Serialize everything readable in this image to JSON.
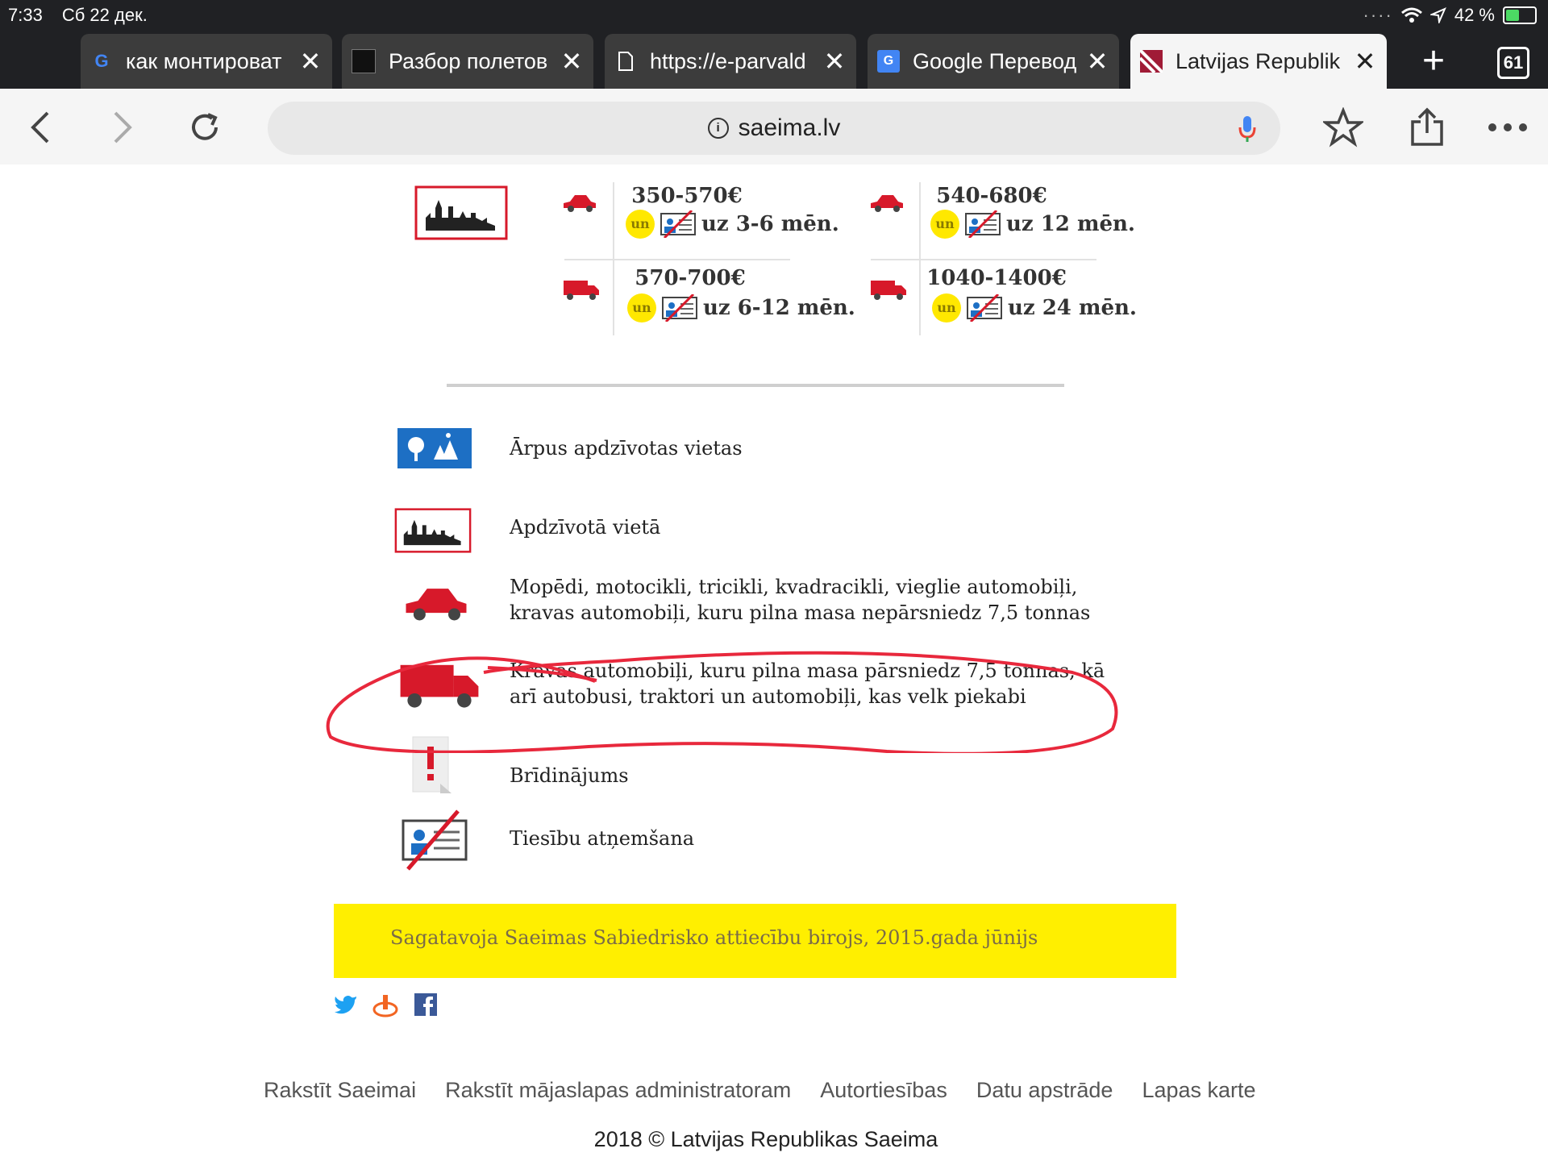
{
  "status": {
    "time": "7:33",
    "date": "Сб 22 дек.",
    "battery": "42 %",
    "battery_level": 0.42
  },
  "tabs": [
    {
      "title": "как монтироват",
      "favicon": "google-icon"
    },
    {
      "title": "Разбор полетов",
      "favicon": "site-icon"
    },
    {
      "title": "https://e-parvald",
      "favicon": "document-icon"
    },
    {
      "title": "Google Перевод",
      "favicon": "google-translate-icon"
    },
    {
      "title": "Latvijas Republik",
      "favicon": "saeima-icon",
      "active": true
    }
  ],
  "tab_count": "61",
  "url": "saeima.lv",
  "penalties": [
    {
      "price": "350-570€",
      "un": "un",
      "duration": "uz 3-6 mēn.",
      "vehicle": "car"
    },
    {
      "price": "540-680€",
      "un": "un",
      "duration": "uz 12 mēn.",
      "vehicle": "car"
    },
    {
      "price": "570-700€",
      "un": "un",
      "duration": "uz 6-12 mēn.",
      "vehicle": "truck"
    },
    {
      "price": "1040-1400€",
      "un": "un",
      "duration": "uz 24 mēn.",
      "vehicle": "truck"
    }
  ],
  "legend": {
    "outside": "Ārpus apdzīvotas vietas",
    "inside": "Apdzīvotā vietā",
    "car": "Mopēdi, motocikli, tricikli, kvadracikli, vieglie automobiļi, kravas automobiļi, kuru pilna masa nepārsniedz 7,5 tonnas",
    "truck": "Kravas automobiļi, kuru pilna masa pārsniedz 7,5 tonnas, kā arī autobusi, traktori un automobiļi, kas velk piekabi",
    "warning": "Brīdinājums",
    "license": "Tiesību atņemšana"
  },
  "banner": "Sagatavoja Saeimas Sabiedrisko attiecību birojs, 2015.gada jūnijs",
  "footer": {
    "links": [
      "Rakstīt Saeimai",
      "Rakstīt mājaslapas administratoram",
      "Autortiesības",
      "Datu apstrāde",
      "Lapas karte"
    ],
    "copyright": "2018 © Latvijas Republikas Saeima"
  },
  "colors": {
    "accent_red": "#d7192a",
    "highlight_yellow": "#ffef00",
    "annotation_red": "#e8283c",
    "sign_blue": "#1d6fc4"
  }
}
